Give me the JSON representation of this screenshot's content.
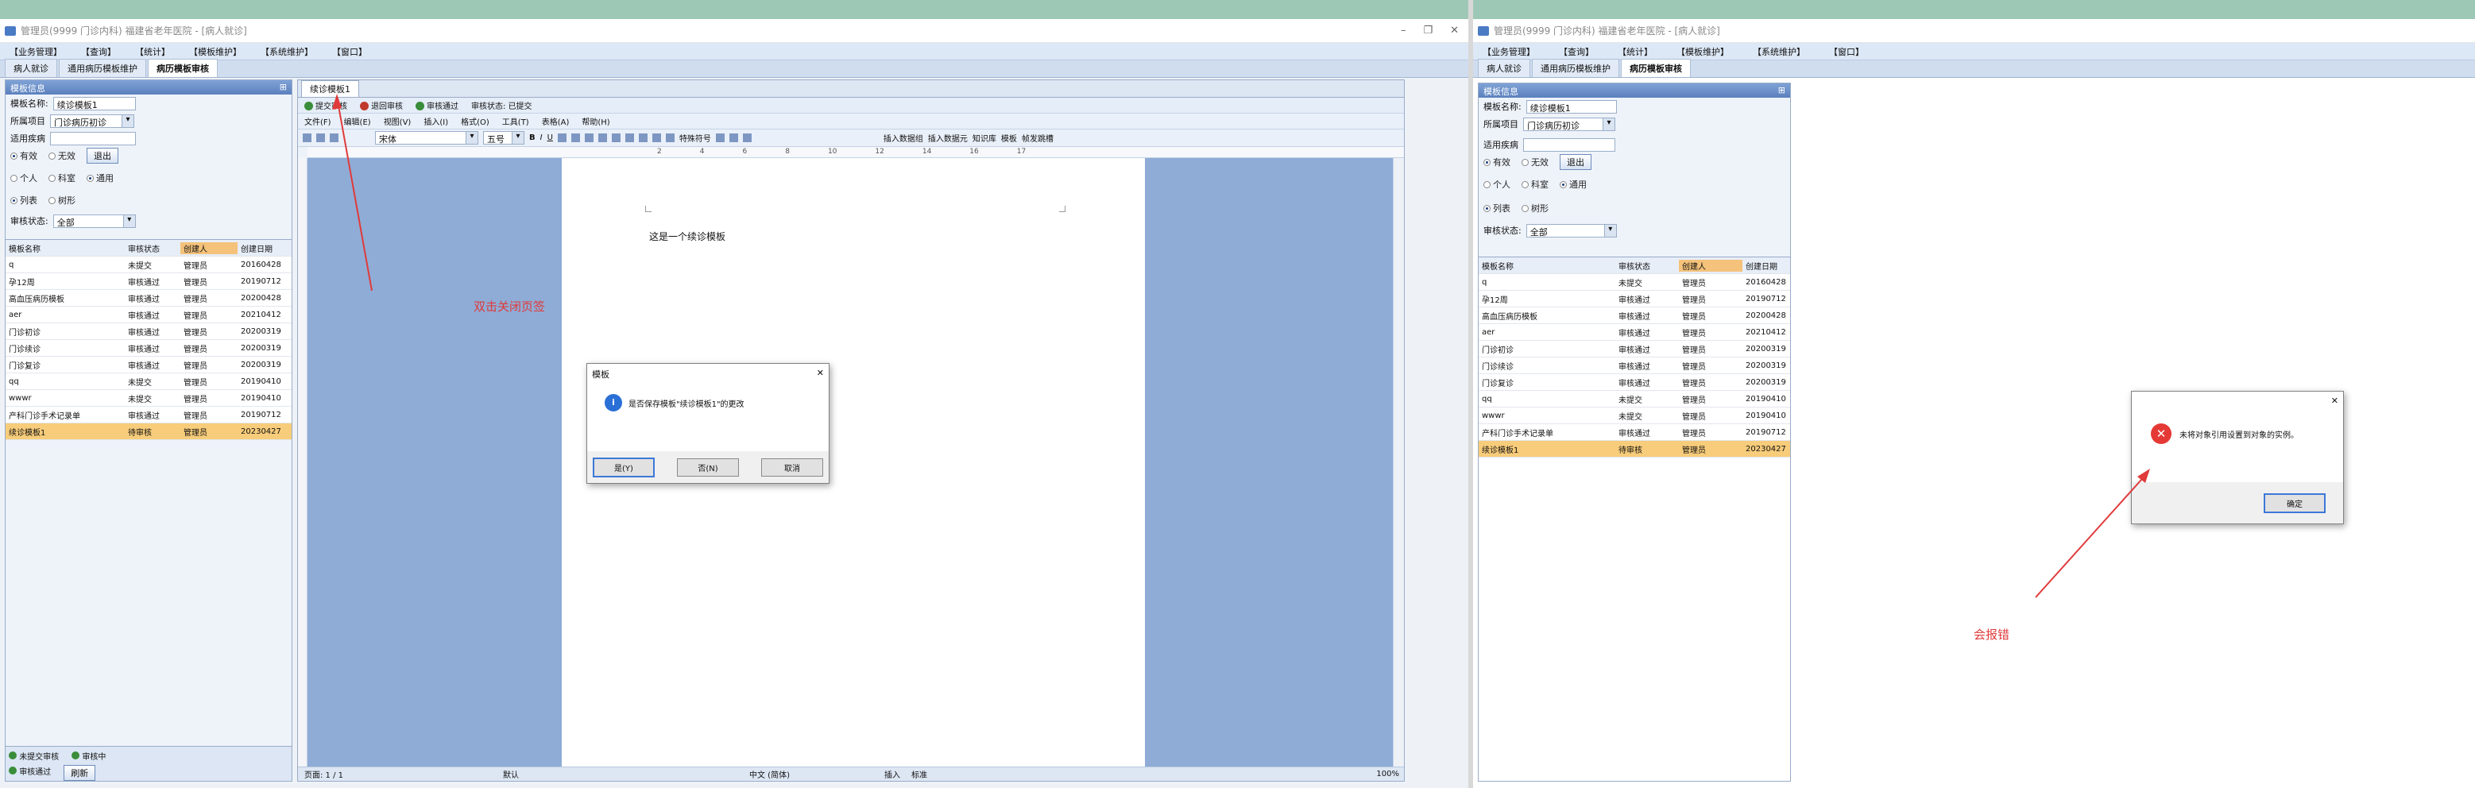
{
  "window_title": "管理员(9999 门诊内科) 福建省老年医院 - [病人就诊]",
  "menu": [
    "【业务管理】",
    "【查询】",
    "【统计】",
    "【模板维护】",
    "【系统维护】",
    "【窗口】"
  ],
  "tabs": [
    "病人就诊",
    "通用病历模板维护",
    "病历模板审核"
  ],
  "left_panel": {
    "title": "模板信息",
    "template_name_label": "模板名称:",
    "template_name_value": "续诊模板1",
    "project_label": "所属项目",
    "project_value": "门诊病历初诊",
    "disease_label": "适用疾病",
    "disease_value": "",
    "valid": "有效",
    "invalid": "无效",
    "exit_button": "退出",
    "personal": "个人",
    "department": "科室",
    "general": "通用",
    "list": "列表",
    "tree": "树形",
    "review_status_label": "审核状态:",
    "review_status_value": "全部",
    "columns": [
      "模板名称",
      "审核状态",
      "创建人",
      "创建日期"
    ],
    "rows": [
      [
        "q",
        "未提交",
        "管理员",
        "20160428"
      ],
      [
        "孕12周",
        "审核通过",
        "管理员",
        "20190712"
      ],
      [
        "高血压病历模板",
        "审核通过",
        "管理员",
        "20200428"
      ],
      [
        "aer",
        "审核通过",
        "管理员",
        "20210412"
      ],
      [
        "门诊初诊",
        "审核通过",
        "管理员",
        "20200319"
      ],
      [
        "门诊续诊",
        "审核通过",
        "管理员",
        "20200319"
      ],
      [
        "门诊复诊",
        "审核通过",
        "管理员",
        "20200319"
      ],
      [
        "qq",
        "未提交",
        "管理员",
        "20190410"
      ],
      [
        "wwwr",
        "未提交",
        "管理员",
        "20190410"
      ],
      [
        "产科门诊手术记录单",
        "审核通过",
        "管理员",
        "20190712"
      ],
      [
        "续诊模板1",
        "待审核",
        "管理员",
        "20230427"
      ]
    ],
    "footer": {
      "not_submitted": "未提交审核",
      "reviewing": "审核中",
      "approved": "审核通过",
      "refresh": "刷新"
    }
  },
  "editor": {
    "doc_tab": "续诊模板1",
    "actions": [
      "提交审核",
      "退回审核",
      "审核通过"
    ],
    "status_label": "审核状态:",
    "status_value": "已提交",
    "menu": [
      "文件(F)",
      "编辑(E)",
      "视图(V)",
      "插入(I)",
      "格式(O)",
      "工具(T)",
      "表格(A)",
      "帮助(H)"
    ],
    "font_name": "宋体",
    "font_size": "五号",
    "special_symbol": "特殊符号",
    "toolbar_right": [
      "插入数据组",
      "插入数据元",
      "知识库",
      "模板",
      "帧发跳槽"
    ],
    "ruler_marks": [
      "2",
      "4",
      "6",
      "8",
      "10",
      "12",
      "14",
      "16",
      "17"
    ],
    "page_text": "这是一个续诊模板",
    "status_bar": [
      "页面: 1 / 1",
      "默认",
      "中文 (简体)",
      "插入",
      "标准"
    ],
    "zoom": "100%"
  },
  "dialog1": {
    "title": "模板",
    "message": "是否保存模板\"续诊模板1\"的更改",
    "buttons": [
      "是(Y)",
      "否(N)",
      "取消"
    ]
  },
  "dialog2": {
    "message": "未将对象引用设置到对象的实例。",
    "button": "确定"
  },
  "annotations": {
    "left": "双击关闭页签",
    "right": "会报错"
  },
  "colors": {
    "annotation": "#e03a3a",
    "selected_row": "#f7cc7a",
    "doc_bg": "#8facd6"
  }
}
